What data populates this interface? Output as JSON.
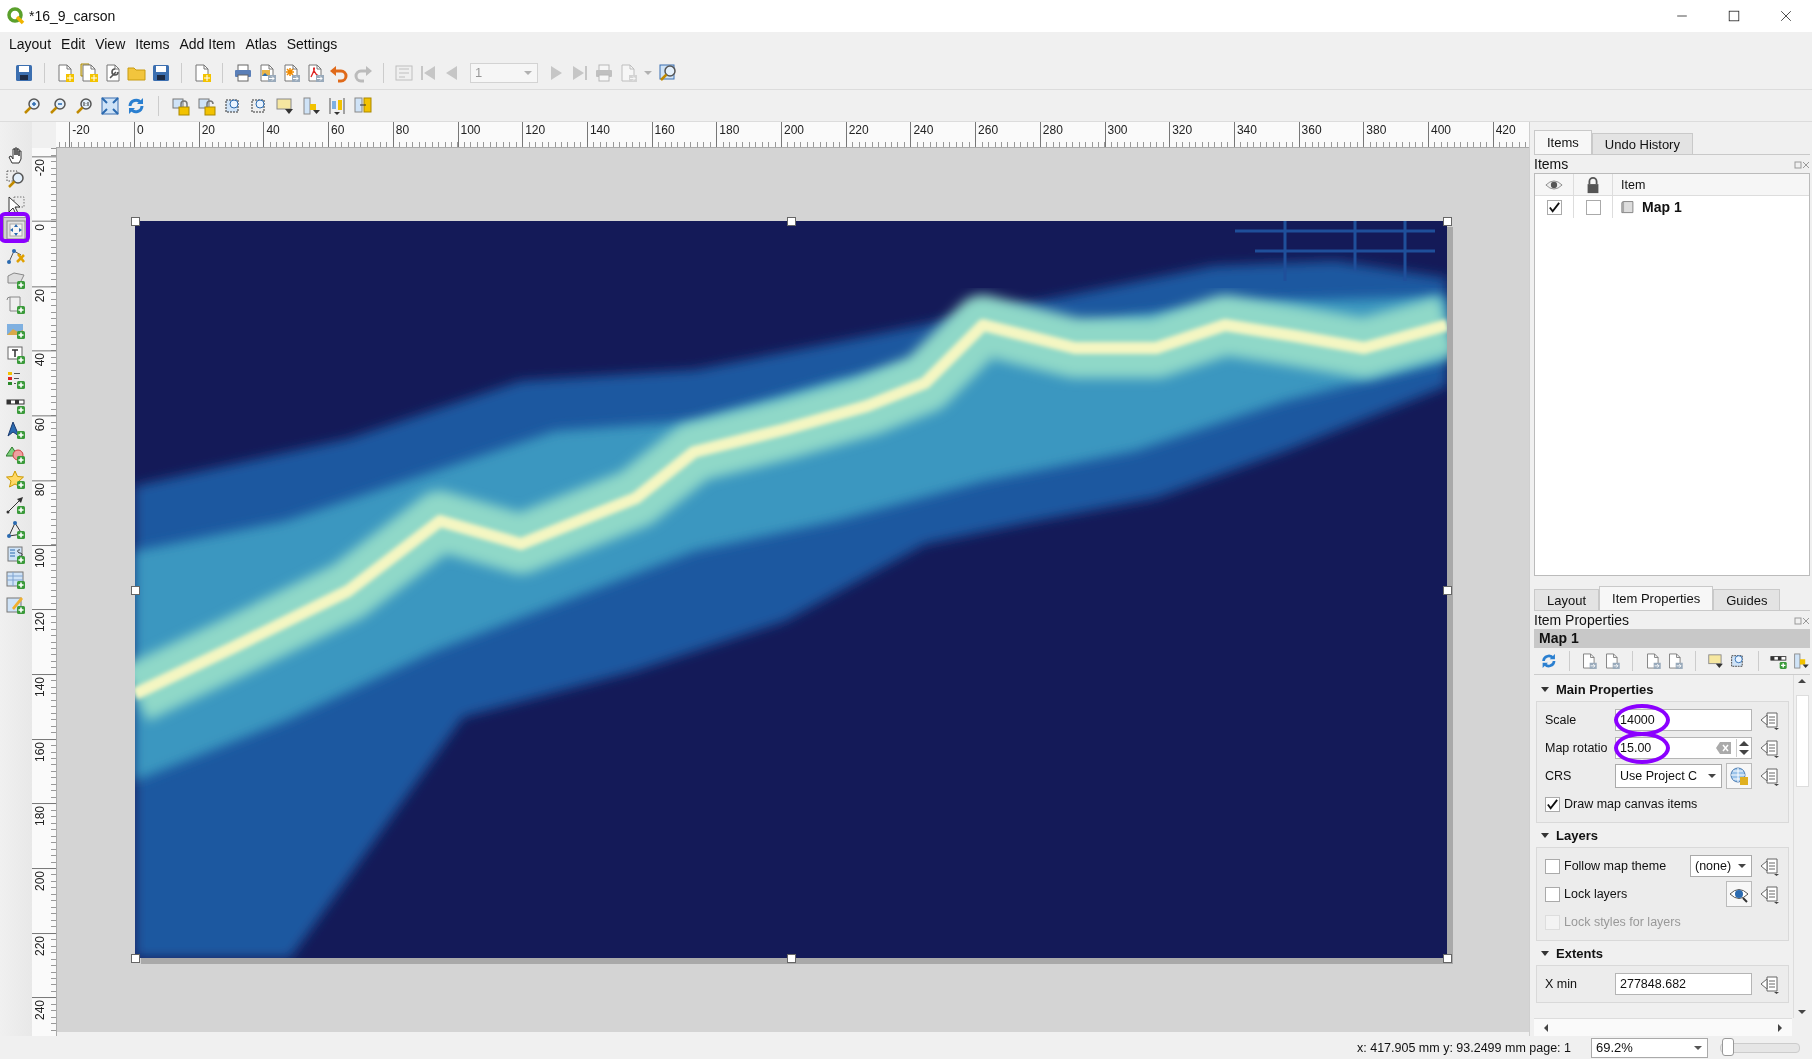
{
  "window": {
    "title": "*16_9_carson"
  },
  "menu": [
    "Layout",
    "Edit",
    "View",
    "Items",
    "Add Item",
    "Atlas",
    "Settings"
  ],
  "atlas_controls": {
    "page": "1",
    "disabled": true
  },
  "tools": [
    {
      "selected": false,
      "annotated": false
    },
    {
      "selected": false,
      "annotated": false
    },
    {
      "selected": false,
      "annotated": false
    },
    {
      "selected": true,
      "annotated": true
    },
    {
      "selected": false,
      "annotated": false
    },
    {
      "selected": false,
      "annotated": false
    },
    {
      "selected": false,
      "annotated": false
    },
    {
      "selected": false,
      "annotated": false
    },
    {
      "selected": false,
      "annotated": false
    },
    {
      "selected": false,
      "annotated": false
    },
    {
      "selected": false,
      "annotated": false
    },
    {
      "selected": false,
      "annotated": false
    },
    {
      "selected": false,
      "annotated": false
    },
    {
      "selected": false,
      "annotated": false
    },
    {
      "selected": false,
      "annotated": false
    },
    {
      "selected": false,
      "annotated": false
    },
    {
      "selected": false,
      "annotated": false
    },
    {
      "selected": false,
      "annotated": false
    },
    {
      "selected": false,
      "annotated": false
    }
  ],
  "rulers": {
    "horizontal": [
      "-20",
      "0",
      "20",
      "40",
      "60",
      "80",
      "100",
      "120",
      "140",
      "160",
      "180",
      "200",
      "220",
      "240",
      "260",
      "280",
      "300",
      "320",
      "340",
      "360",
      "380",
      "400",
      "420"
    ],
    "vertical": [
      "-20",
      "0",
      "20",
      "40",
      "60",
      "80",
      "100",
      "120",
      "140",
      "160",
      "180",
      "200",
      "220",
      "240"
    ]
  },
  "map_item": {
    "selected": true
  },
  "items_dock": {
    "tabs": [
      {
        "label": "Items",
        "selected": true
      },
      {
        "label": "Undo History",
        "selected": false
      }
    ],
    "title": "Items",
    "header": "Item",
    "rows": [
      {
        "name": "Map 1",
        "visible": true,
        "locked": false
      }
    ]
  },
  "properties_dock": {
    "tabs": [
      {
        "label": "Layout",
        "selected": false
      },
      {
        "label": "Item Properties",
        "selected": true
      },
      {
        "label": "Guides",
        "selected": false
      }
    ],
    "title": "Item Properties",
    "item": "Map 1",
    "sections": [
      {
        "title": "Main Properties",
        "expanded": true,
        "rows": [
          {
            "kind": "text",
            "label": "Scale",
            "value": "14000",
            "annotated": true
          },
          {
            "kind": "spin",
            "label": "Map rotatio",
            "value": "15.00",
            "annotated": true
          },
          {
            "kind": "combo",
            "label": "CRS",
            "value": "Use Project C"
          },
          {
            "kind": "check",
            "label": "Draw map canvas items",
            "checked": true,
            "disabled": false
          }
        ]
      },
      {
        "title": "Layers",
        "expanded": true,
        "rows": [
          {
            "kind": "check_combo",
            "label": "Follow map theme",
            "checked": false,
            "value": "(none)"
          },
          {
            "kind": "check_button",
            "label": "Lock layers",
            "checked": false
          },
          {
            "kind": "check",
            "label": "Lock styles for layers",
            "checked": false,
            "disabled": true
          }
        ]
      },
      {
        "title": "Extents",
        "expanded": true,
        "rows": [
          {
            "kind": "text",
            "label": "X min",
            "value": "277848.682",
            "annotated": false
          }
        ]
      }
    ]
  },
  "status_bar": {
    "position": "x: 417.905 mm y: 93.2499 mm page: 1",
    "zoom": "69.2%",
    "zoom_slider": {
      "level": 0.04
    }
  }
}
